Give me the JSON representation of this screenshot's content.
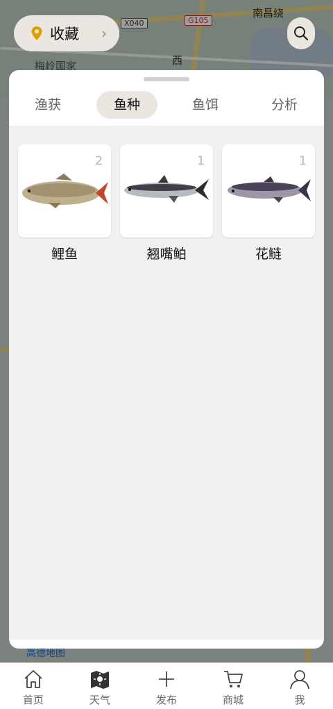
{
  "map": {
    "labels": [
      "南昌绕",
      "梅岭国家",
      "西"
    ],
    "shields": [
      "X040",
      "G105"
    ],
    "watermark": "高德地图"
  },
  "header": {
    "favorites_label": "收藏"
  },
  "tabs": [
    {
      "label": "渔获",
      "active": false
    },
    {
      "label": "鱼种",
      "active": true
    },
    {
      "label": "鱼饵",
      "active": false
    },
    {
      "label": "分析",
      "active": false
    }
  ],
  "fish": [
    {
      "name": "鲤鱼",
      "count": "2",
      "icon": "carp-image"
    },
    {
      "name": "翘嘴鲌",
      "count": "1",
      "icon": "topmouth-culter-image"
    },
    {
      "name": "花鲢",
      "count": "1",
      "icon": "bighead-carp-image"
    }
  ],
  "nav": [
    {
      "label": "首页",
      "icon": "home-icon"
    },
    {
      "label": "天气",
      "icon": "weather-icon"
    },
    {
      "label": "发布",
      "icon": "plus-icon"
    },
    {
      "label": "商城",
      "icon": "cart-icon"
    },
    {
      "label": "我",
      "icon": "user-icon"
    }
  ]
}
